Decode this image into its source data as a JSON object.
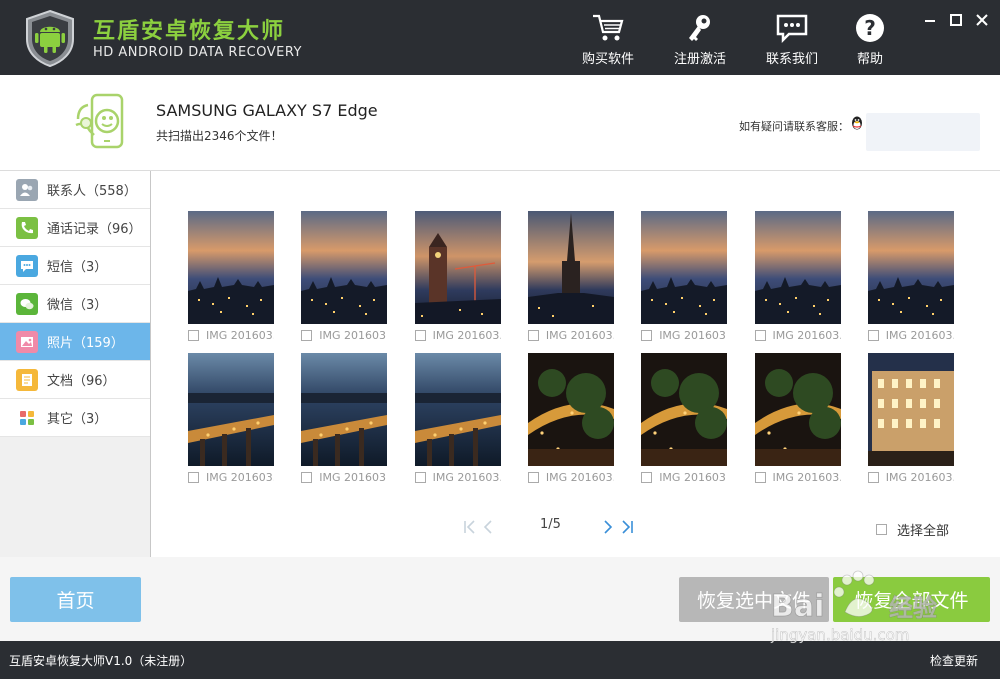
{
  "app": {
    "name": "互盾安卓恢复大师",
    "subtitle": "HD ANDROID DATA RECOVERY"
  },
  "topnav": [
    {
      "label": "购买软件",
      "icon": "cart-icon"
    },
    {
      "label": "注册激活",
      "icon": "key-icon"
    },
    {
      "label": "联系我们",
      "icon": "chat-icon"
    },
    {
      "label": "帮助",
      "icon": "help-icon"
    }
  ],
  "device": {
    "name": "SAMSUNG  GALAXY S7 Edge",
    "count_text": "共扫描出2346个文件！",
    "help_text": "如有疑问请联系客服："
  },
  "sidebar": {
    "items": [
      {
        "label": "联系人（558）",
        "icon": "contacts-icon",
        "color": "#9aa6b2"
      },
      {
        "label": "通话记录（96）",
        "icon": "phone-icon",
        "color": "#7bc043"
      },
      {
        "label": "短信（3）",
        "icon": "message-icon",
        "color": "#4aa8e0"
      },
      {
        "label": "微信（3）",
        "icon": "wechat-icon",
        "color": "#5bb53a"
      },
      {
        "label": "照片（159）",
        "icon": "photo-icon",
        "color": "#f08aa8",
        "active": true
      },
      {
        "label": "文档（96）",
        "icon": "document-icon",
        "color": "#f5b83a"
      },
      {
        "label": "其它（3）",
        "icon": "other-icon",
        "color": "#e86a6a"
      }
    ]
  },
  "photos": [
    {
      "caption": "IMG 201603...",
      "scene": "dusk-skyline"
    },
    {
      "caption": "IMG 201603...",
      "scene": "dusk-skyline"
    },
    {
      "caption": "IMG 201603...",
      "scene": "clock-tower"
    },
    {
      "caption": "IMG 201603...",
      "scene": "church-spire"
    },
    {
      "caption": "IMG 201603...",
      "scene": "dusk-skyline"
    },
    {
      "caption": "IMG 201603...",
      "scene": "dusk-skyline"
    },
    {
      "caption": "IMG 201603...",
      "scene": "dusk-skyline"
    },
    {
      "caption": "IMG 201603...",
      "scene": "harbor-bridge"
    },
    {
      "caption": "IMG 201603...",
      "scene": "harbor-bridge"
    },
    {
      "caption": "IMG 201603...",
      "scene": "harbor-bridge"
    },
    {
      "caption": "IMG 201603...",
      "scene": "night-trees"
    },
    {
      "caption": "IMG 201603...",
      "scene": "night-trees"
    },
    {
      "caption": "IMG 201603...",
      "scene": "night-trees"
    },
    {
      "caption": "IMG 201603...",
      "scene": "night-building"
    }
  ],
  "pagination": {
    "page_text": "1/5"
  },
  "select_all_label": "选择全部",
  "buttons": {
    "home": "首页",
    "recover_selected": "恢复选中文件",
    "recover_all": "恢复全部文件"
  },
  "status": {
    "text": "互盾安卓恢复大师V1.0（未注册）",
    "update_label": "检查更新"
  },
  "colors": {
    "titlebar": "#2b2e33",
    "brand_green": "#8cd03f",
    "active_blue": "#6cb6ea",
    "recover_all": "#8acb3f"
  }
}
